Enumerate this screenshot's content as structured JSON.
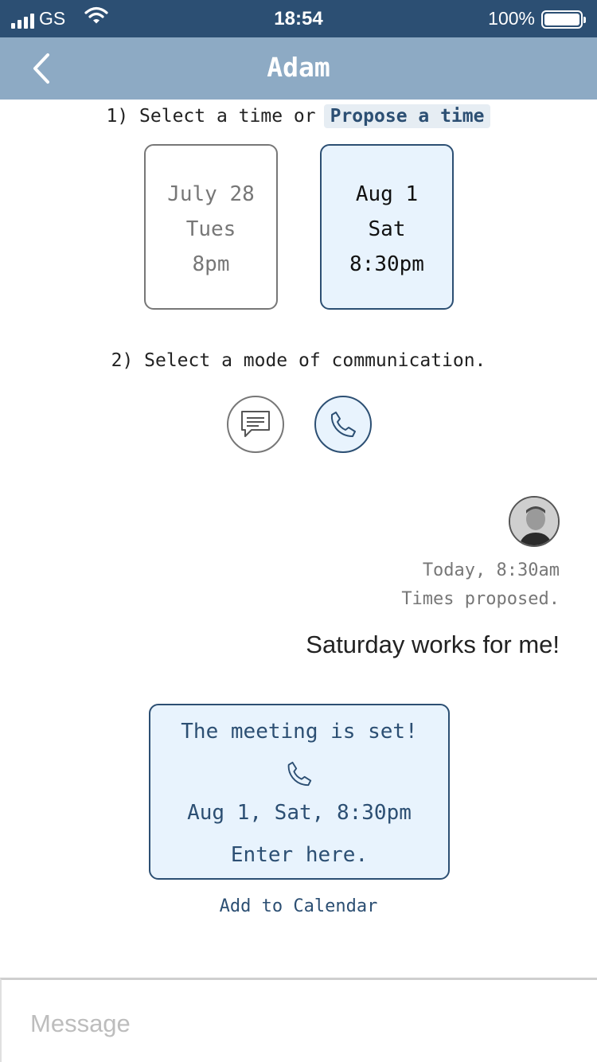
{
  "status_bar": {
    "carrier": "GS",
    "time": "18:54",
    "battery": "100%"
  },
  "nav": {
    "title": "Adam",
    "back_icon": "chevron-left-icon"
  },
  "step1": {
    "label": "1) Select a time or",
    "propose_label": "Propose a time"
  },
  "time_slots": [
    {
      "date": "July 28",
      "day": "Tues",
      "time": "8pm",
      "selected": false
    },
    {
      "date": "Aug 1",
      "day": "Sat",
      "time": "8:30pm",
      "selected": true
    }
  ],
  "step2": {
    "label": "2) Select a mode of communication."
  },
  "modes": [
    {
      "icon": "chat-bubble-icon",
      "selected": false
    },
    {
      "icon": "phone-icon",
      "selected": true
    }
  ],
  "message": {
    "timestamp": "Today, 8:30am",
    "note": "Times proposed.",
    "text": "Saturday works for me!"
  },
  "confirmation": {
    "title": "The meeting is set!",
    "icon": "phone-icon",
    "datetime": "Aug 1, Sat, 8:30pm",
    "action": "Enter here."
  },
  "calendar_link": "Add to Calendar",
  "composer": {
    "placeholder": "Message",
    "value": ""
  },
  "colors": {
    "status_bar": "#2c4f73",
    "nav_bar": "#8daac4",
    "accent": "#2c4f73",
    "selected_fill": "#e8f3fd"
  }
}
